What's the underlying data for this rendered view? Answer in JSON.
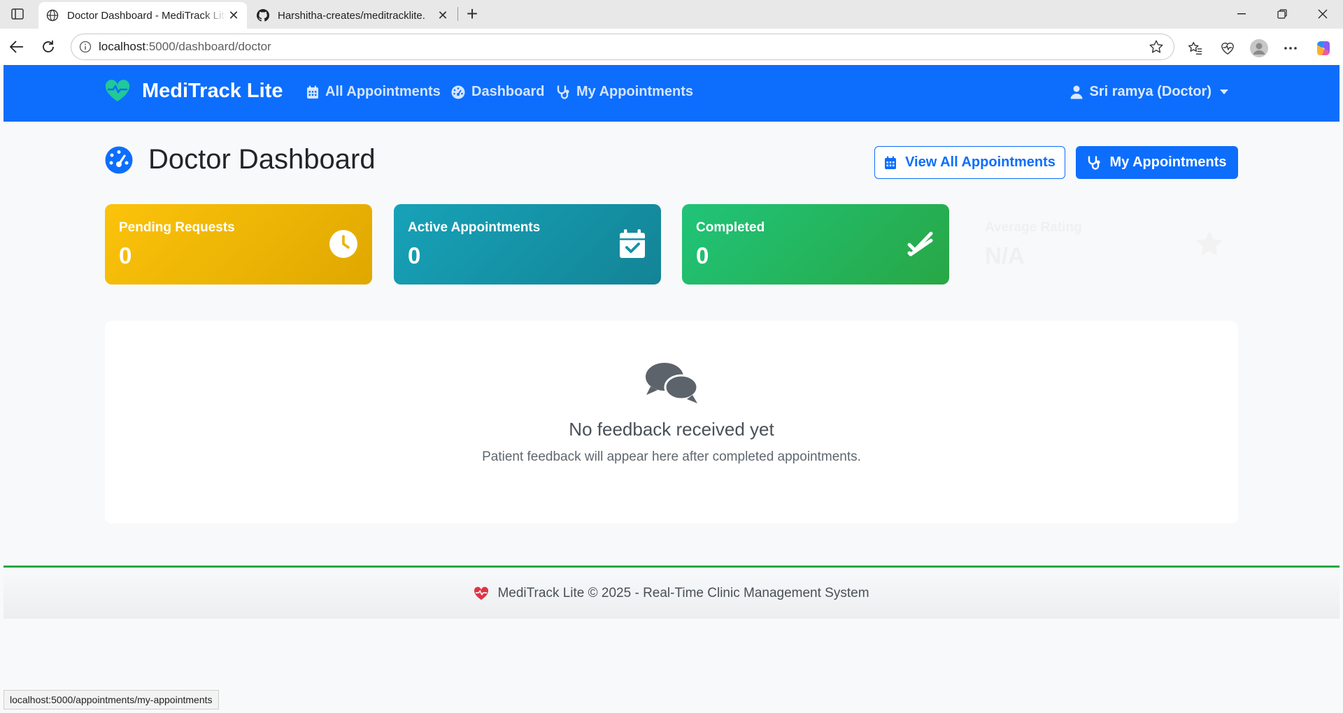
{
  "browser": {
    "tabs": [
      {
        "title": "Doctor Dashboard - MediTrack Lite",
        "active": true
      },
      {
        "title": "Harshitha-creates/meditracklite.",
        "active": false
      }
    ],
    "url_host": "localhost",
    "url_path": ":5000/dashboard/doctor",
    "status_url": "localhost:5000/appointments/my-appointments"
  },
  "navbar": {
    "brand": "MediTrack Lite",
    "links": [
      {
        "label": "All Appointments",
        "icon": "calendar-icon"
      },
      {
        "label": "Dashboard",
        "icon": "dashboard-gauge-icon"
      },
      {
        "label": "My Appointments",
        "icon": "stethoscope-icon"
      }
    ],
    "user": "Sri ramya (Doctor)"
  },
  "main": {
    "title": "Doctor Dashboard",
    "view_all_button": "View All Appointments",
    "my_appointments_button": "My Appointments",
    "stats": [
      {
        "label": "Pending Requests",
        "value": "0",
        "icon": "clock-icon",
        "color": "#f4b400"
      },
      {
        "label": "Active Appointments",
        "value": "0",
        "icon": "calendar-check-icon",
        "color": "#17a2b8"
      },
      {
        "label": "Completed",
        "value": "0",
        "icon": "double-check-icon",
        "color": "#28a745"
      },
      {
        "label": "Average Rating",
        "value": "N/A",
        "icon": "star-icon",
        "color": "#ffffff"
      }
    ],
    "feedback": {
      "title": "No feedback received yet",
      "subtitle": "Patient feedback will appear here after completed appointments."
    }
  },
  "footer": {
    "text": "MediTrack Lite © 2025 - Real-Time Clinic Management System"
  },
  "colors": {
    "primary": "#0d6efd",
    "success": "#28a745",
    "warning": "#ffc107",
    "info": "#17a2b8"
  }
}
